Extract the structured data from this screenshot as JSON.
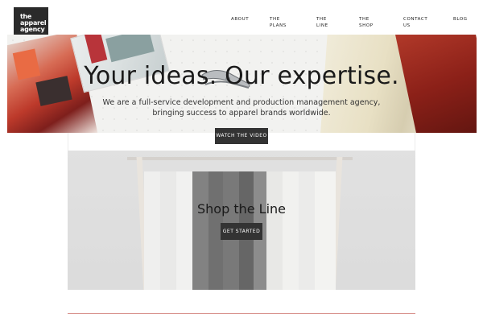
{
  "brand": {
    "logo_lines": [
      "the",
      "apparel",
      "agency"
    ]
  },
  "nav": [
    {
      "lines": [
        "ABOUT"
      ]
    },
    {
      "lines": [
        "THE",
        "PLANS"
      ]
    },
    {
      "lines": [
        "THE",
        "LINE"
      ]
    },
    {
      "lines": [
        "THE",
        "SHOP"
      ]
    },
    {
      "lines": [
        "CONTACT",
        "US"
      ]
    },
    {
      "lines": [
        "BLOG"
      ]
    }
  ],
  "hero": {
    "title": "Your ideas. Our expertise.",
    "subtitle_lines": [
      "We are a full-service development and production management agency,",
      "bringing success to apparel brands worldwide."
    ],
    "button": "WATCH THE VIDEO"
  },
  "shop": {
    "title": "Shop the Line",
    "button": "GET STARTED"
  },
  "colors": {
    "button_bg": "#333333",
    "accent_rule": "#d9938e"
  }
}
